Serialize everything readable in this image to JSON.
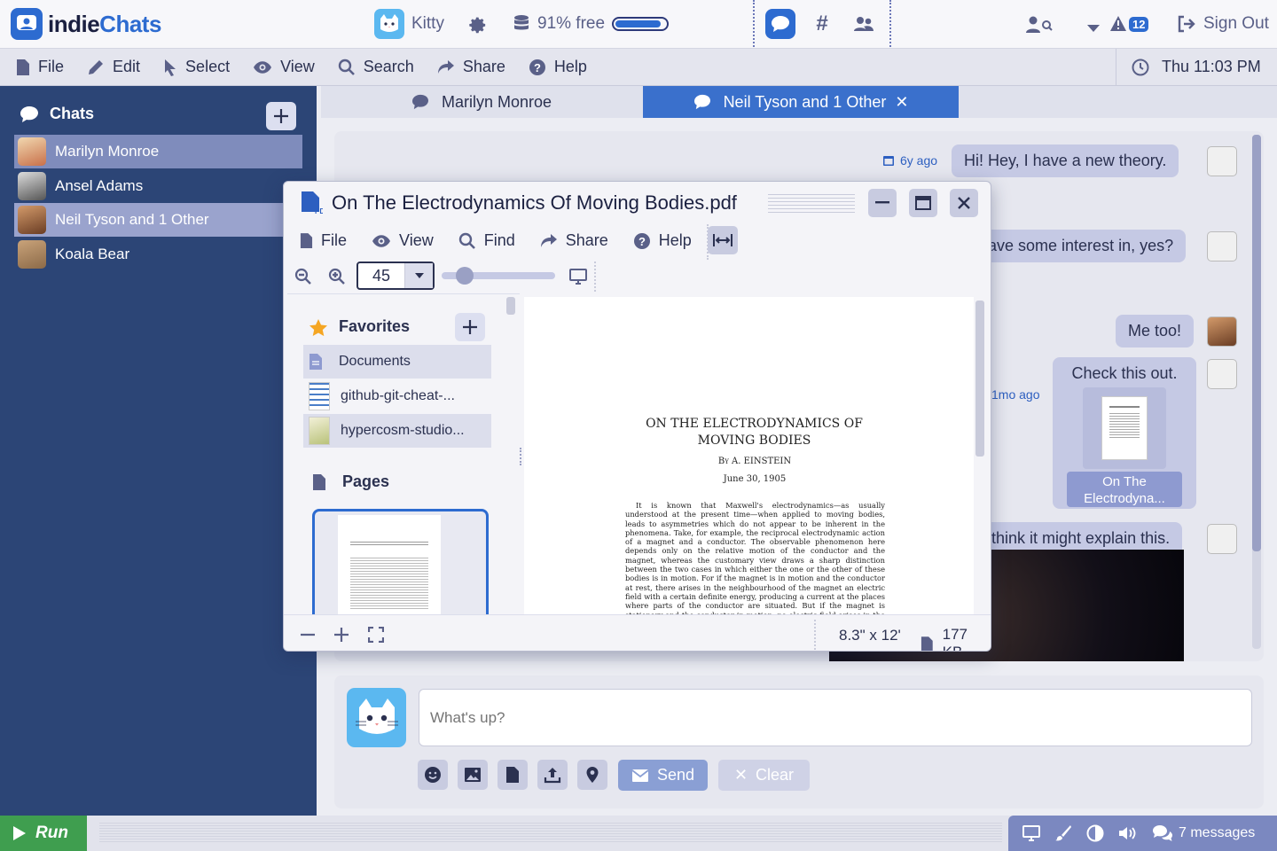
{
  "app": {
    "logo_prefix": "indie",
    "logo_suffix": "Chats",
    "user": "Kitty",
    "storage": "91% free",
    "storage_fraction": 0.91,
    "sign_out": "Sign Out",
    "notif_count": "12"
  },
  "menu": {
    "file": "File",
    "edit": "Edit",
    "select": "Select",
    "view": "View",
    "search": "Search",
    "share": "Share",
    "help": "Help",
    "clock": "Thu 11:03 PM"
  },
  "sidebar": {
    "title": "Chats",
    "items": [
      {
        "label": "Marilyn Monroe"
      },
      {
        "label": "Ansel Adams"
      },
      {
        "label": "Neil Tyson and 1 Other"
      },
      {
        "label": "Koala Bear"
      }
    ]
  },
  "tabs": [
    {
      "label": "Marilyn Monroe"
    },
    {
      "label": "Neil Tyson and 1 Other"
    }
  ],
  "messages": [
    {
      "text": "Hi!   Hey, I have a new theory.",
      "time": "6y ago"
    },
    {
      "text": "ave some interest in, yes?"
    },
    {
      "text": "Me too!"
    },
    {
      "text": "Check this out.",
      "time": "1mo ago",
      "attachment": "On The Electrodyna..."
    },
    {
      "text": "think it might explain this."
    }
  ],
  "composer": {
    "placeholder": "What's up?",
    "send": "Send",
    "clear": "Clear"
  },
  "pdf": {
    "title": "On The Electrodynamics Of Moving Bodies.pdf",
    "menu": {
      "file": "File",
      "view": "View",
      "find": "Find",
      "share": "Share",
      "help": "Help"
    },
    "zoom": "45",
    "zoom_fraction": 0.2,
    "favorites_title": "Favorites",
    "favorites": [
      {
        "label": "Documents"
      },
      {
        "label": "github-git-cheat-..."
      },
      {
        "label": "hypercosm-studio..."
      }
    ],
    "pages_title": "Pages",
    "page_size": "8.3\" x 12'",
    "file_size": "177 KB",
    "doc": {
      "heading": "ON THE ELECTRODYNAMICS OF MOVING BODIES",
      "author": "By A. EINSTEIN",
      "date": "June 30, 1905",
      "body": "It is known that Maxwell's electrodynamics—as usually understood at the present time—when applied to moving bodies, leads to asymmetries which do not appear to be inherent in the phenomena. Take, for example, the reciprocal electrodynamic action of a magnet and a conductor. The observable phenomenon here depends only on the relative motion of the conductor and the magnet, whereas the customary view draws a sharp distinction between the two cases in which either the one or the other of these bodies is in motion. For if the magnet is in motion and the conductor at rest, there arises in the neighbourhood of the magnet an electric field with a certain definite energy, producing a current at the places where parts of the conductor are situated. But if the magnet is stationary and the conductor in motion, no electric field arises in the neighbourhood of the magnet. In the conductor, however, we find an electromotive force, to which in itself there is no corresponding energy, but which gives"
    }
  },
  "footer": {
    "run": "Run",
    "messages": "7 messages"
  },
  "colors": {
    "accent": "#2d6bd0",
    "sidebar": "#2c4576",
    "run": "#3f9e4f"
  }
}
